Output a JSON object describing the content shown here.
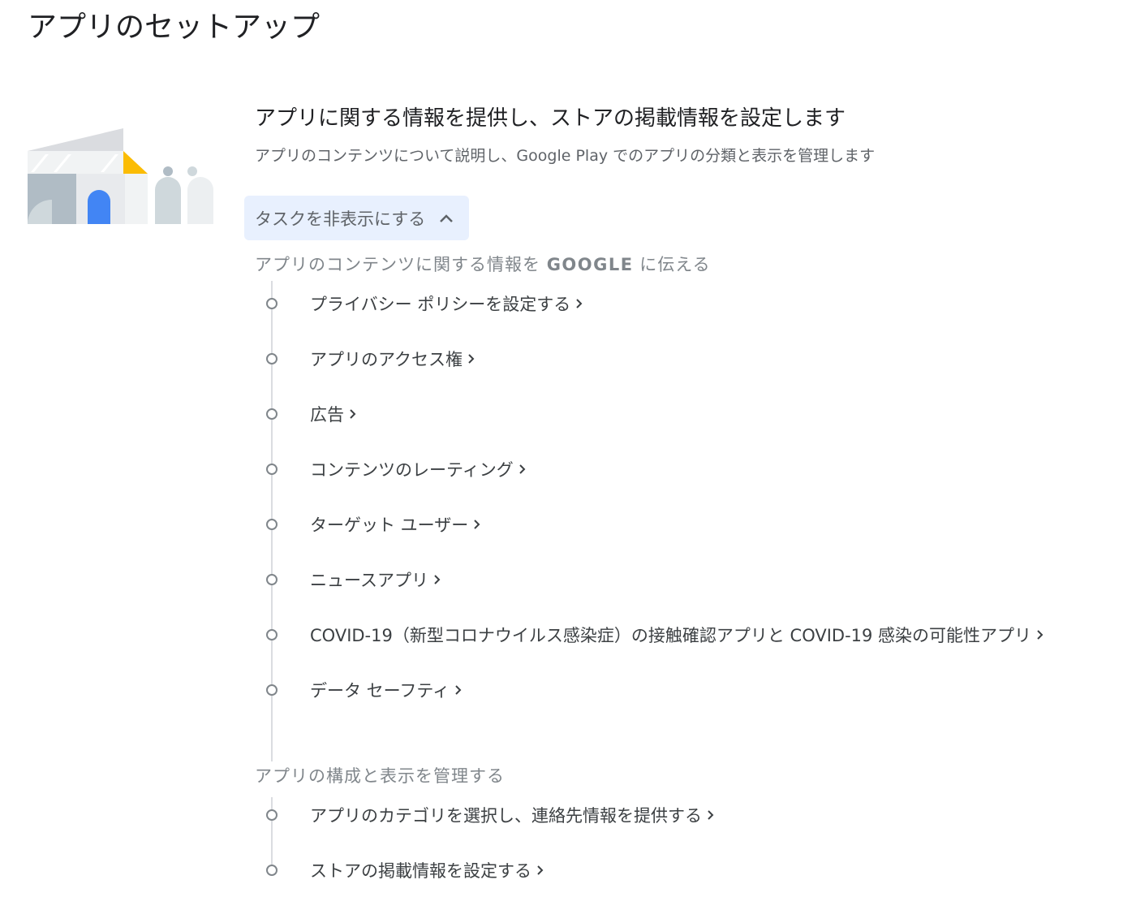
{
  "page": {
    "title": "アプリのセットアップ"
  },
  "card": {
    "heading": "アプリに関する情報を提供し、ストアの掲載情報を設定します",
    "description": "アプリのコンテンツについて説明し、Google Play でのアプリの分類と表示を管理します",
    "toggle_label": "タスクを非表示にする"
  },
  "sections": [
    {
      "header_prefix": "アプリのコンテンツに関する情報を ",
      "header_emphasis": "GOOGLE",
      "header_suffix": " に伝える",
      "tasks": [
        {
          "label": "プライバシー ポリシーを設定する"
        },
        {
          "label": "アプリのアクセス権"
        },
        {
          "label": "広告"
        },
        {
          "label": "コンテンツのレーティング"
        },
        {
          "label": "ターゲット ユーザー"
        },
        {
          "label": "ニュースアプリ"
        },
        {
          "label": "COVID-19（新型コロナウイルス感染症）の接触確認アプリと COVID-19 感染の可能性アプリ"
        },
        {
          "label": "データ セーフティ"
        }
      ]
    },
    {
      "header_prefix": "アプリの構成と表示を管理する",
      "tasks": [
        {
          "label": "アプリのカテゴリを選択し、連絡先情報を提供する"
        },
        {
          "label": "ストアの掲載情報を設定する"
        }
      ]
    }
  ],
  "colors": {
    "accent_blue": "#4285f4",
    "accent_yellow": "#fbbc04",
    "toggle_bg": "#e8f0fe",
    "dot_gray": "#80868b"
  }
}
